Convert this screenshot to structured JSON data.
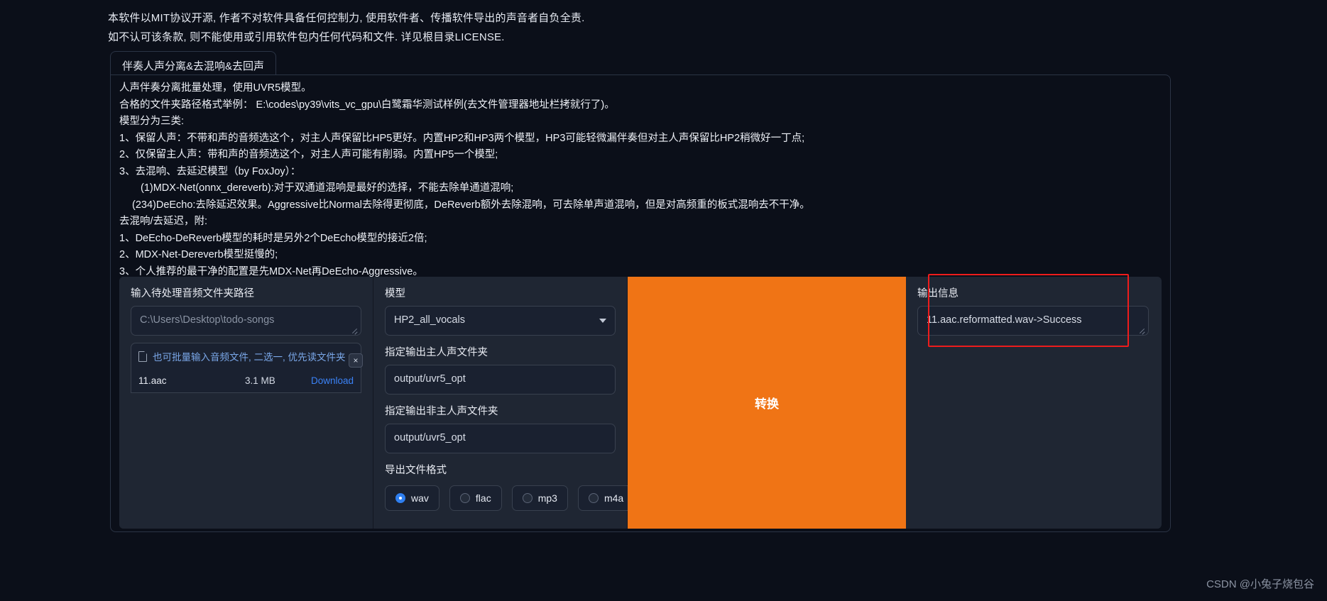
{
  "legal": {
    "line1": "本软件以MIT协议开源, 作者不对软件具备任何控制力, 使用软件者、传播软件导出的声音者自负全责.",
    "line2": "如不认可该条款, 则不能使用或引用软件包内任何代码和文件. 详见根目录LICENSE."
  },
  "tab": {
    "label": "伴奏人声分离&去混响&去回声"
  },
  "description": [
    "人声伴奏分离批量处理，使用UVR5模型。",
    "合格的文件夹路径格式举例： E:\\codes\\py39\\vits_vc_gpu\\白鹭霜华测试样例(去文件管理器地址栏拷就行了)。",
    "模型分为三类:",
    "1、保留人声：不带和声的音频选这个，对主人声保留比HP5更好。内置HP2和HP3两个模型，HP3可能轻微漏伴奏但对主人声保留比HP2稍微好一丁点;",
    "2、仅保留主人声：带和声的音频选这个，对主人声可能有削弱。内置HP5一个模型;",
    "3、去混响、去延迟模型（by FoxJoy）：",
    "(1)MDX-Net(onnx_dereverb):对于双通道混响是最好的选择，不能去除单通道混响;",
    "(234)DeEcho:去除延迟效果。Aggressive比Normal去除得更彻底，DeReverb额外去除混响，可去除单声道混响，但是对高频重的板式混响去不干净。",
    "去混响/去延迟，附:",
    "1、DeEcho-DeReverb模型的耗时是另外2个DeEcho模型的接近2倍;",
    "2、MDX-Net-Dereverb模型挺慢的;",
    "3、个人推荐的最干净的配置是先MDX-Net再DeEcho-Aggressive。"
  ],
  "input_column": {
    "label": "输入待处理音频文件夹路径",
    "placeholder": "C:\\Users\\Desktop\\todo-songs",
    "value": "",
    "upload_hint": "也可批量输入音频文件, 二选一, 优先读文件夹",
    "clear_label": "×",
    "file": {
      "name": "11.aac",
      "size": "3.1 MB",
      "download_label": "Download"
    }
  },
  "settings_column": {
    "model_label": "模型",
    "model_value": "HP2_all_vocals",
    "vocal_out_label": "指定输出主人声文件夹",
    "vocal_out_value": "output/uvr5_opt",
    "inst_out_label": "指定输出非主人声文件夹",
    "inst_out_value": "output/uvr5_opt",
    "format_label": "导出文件格式",
    "formats": [
      {
        "label": "wav",
        "selected": true
      },
      {
        "label": "flac",
        "selected": false
      },
      {
        "label": "mp3",
        "selected": false
      },
      {
        "label": "m4a",
        "selected": false
      }
    ]
  },
  "convert_button": {
    "label": "转换",
    "color": "#f07415"
  },
  "output_column": {
    "label": "输出信息",
    "value": "11.aac.reformatted.wav->Success",
    "highlight_color": "#ee1c1c"
  },
  "watermark": "CSDN @小兔子烧包谷"
}
